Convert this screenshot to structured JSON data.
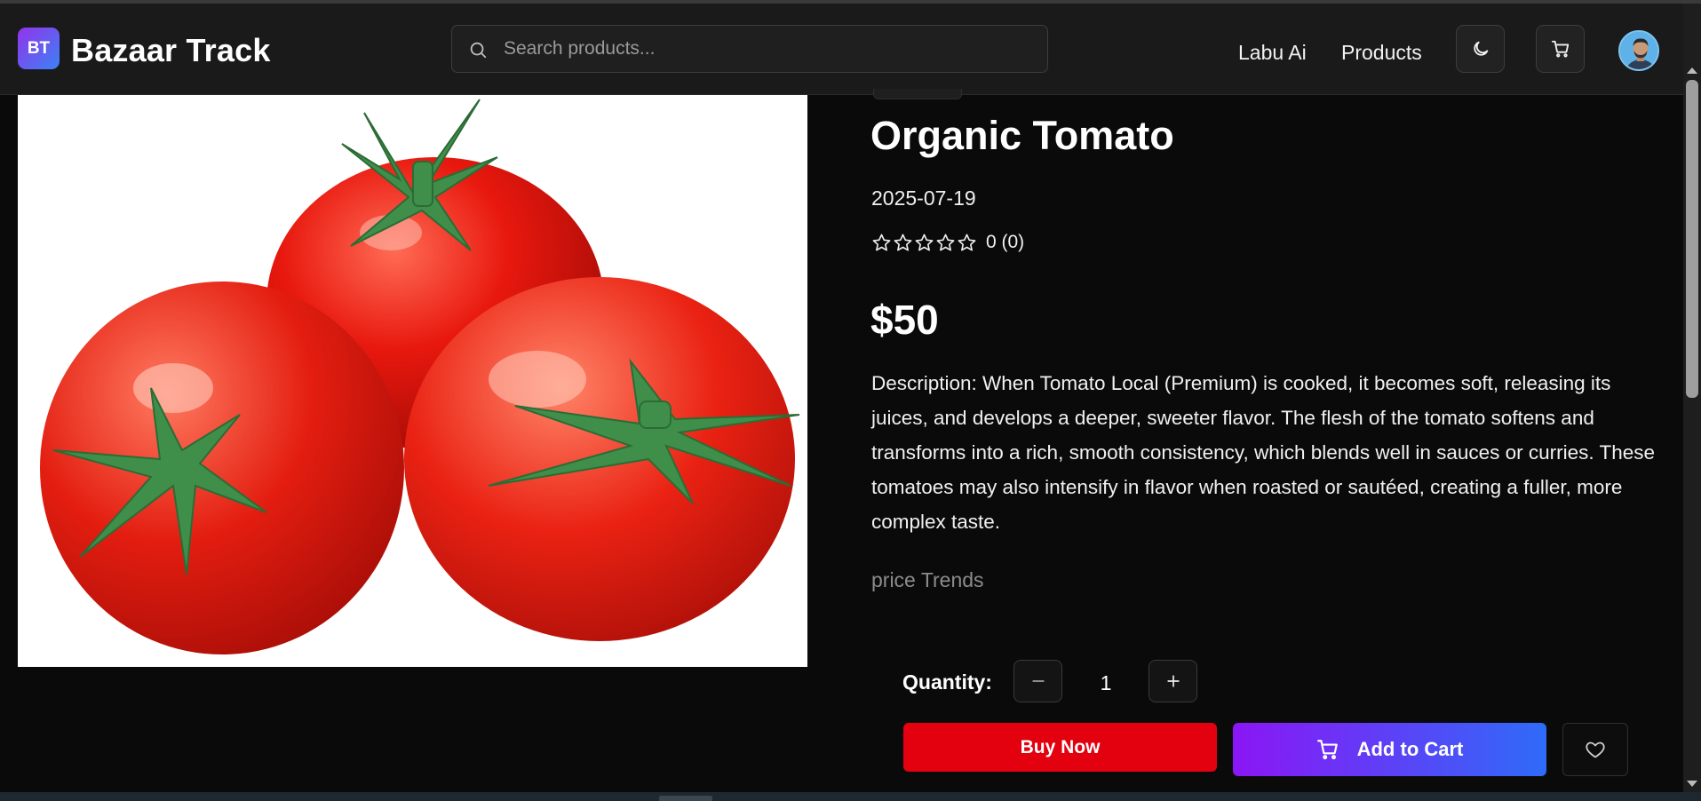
{
  "header": {
    "logo_badge": "BT",
    "brand": "Bazaar Track",
    "search_placeholder": "Search products...",
    "nav_links": [
      "Labu Ai",
      "Products"
    ],
    "icons": [
      "moon-icon",
      "cart-icon"
    ]
  },
  "product": {
    "image_alt": "Organic Tomato",
    "title": "Organic Tomato",
    "date": "2025-07-19",
    "rating": {
      "value": 0,
      "count": 0,
      "max": 5,
      "text": "0 (0)"
    },
    "price": "$50",
    "description": "Description: When Tomato Local (Premium) is cooked, it becomes soft, releasing its juices, and develops a deeper, sweeter flavor. The flesh of the tomato softens and transforms into a rich, smooth consistency, which blends well in sauces or curries. These tomatoes may also intensify in flavor when roasted or sautéed, creating a fuller, more complex taste.",
    "trends_label": "price Trends"
  },
  "purchase": {
    "quantity_label": "Quantity:",
    "quantity": "1",
    "buy_now": "Buy Now",
    "add_to_cart": "Add to Cart"
  },
  "colors": {
    "background": "#0a0a0a",
    "header": "#1a1a1a",
    "buy_button": "#e3000f",
    "cart_gradient_start": "#8b16f5",
    "cart_gradient_end": "#2f6bf8"
  }
}
